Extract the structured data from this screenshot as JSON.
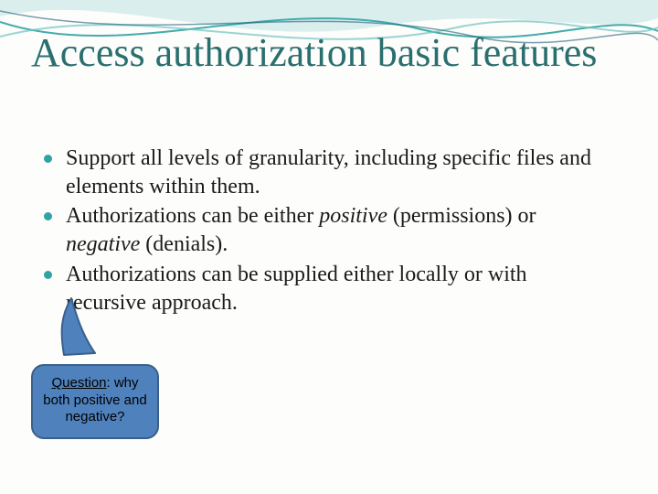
{
  "title": "Access authorization basic features",
  "bullets": [
    {
      "pre": "Support all levels of granularity, including specific files and elements within them.",
      "em1": "",
      "mid": "",
      "em2": "",
      "post": ""
    },
    {
      "pre": "Authorizations can be either ",
      "em1": "positive",
      "mid": " (permissions) or ",
      "em2": "negative",
      "post": " (denials)."
    },
    {
      "pre": "Authorizations can be supplied either locally or with recursive approach.",
      "em1": "",
      "mid": "",
      "em2": "",
      "post": ""
    }
  ],
  "callout": {
    "label": "Question",
    "text": ": why both positive and negative?"
  },
  "colors": {
    "accent": "#2a6f6f",
    "bullet": "#2fa3a3",
    "callout_fill": "#4f81bd",
    "callout_border": "#3a5f8a"
  }
}
